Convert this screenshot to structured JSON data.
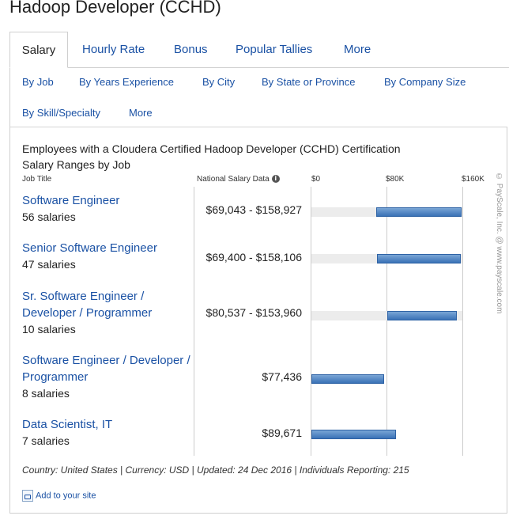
{
  "page": {
    "title": "Hadoop Developer (CCHD)"
  },
  "tabs": [
    {
      "label": "Salary",
      "active": true
    },
    {
      "label": "Hourly Rate"
    },
    {
      "label": "Bonus"
    },
    {
      "label": "Popular Tallies"
    },
    {
      "label": "More"
    }
  ],
  "subtabs": [
    {
      "label": "By Job"
    },
    {
      "label": "By Years Experience"
    },
    {
      "label": "By City"
    },
    {
      "label": "By State or Province"
    },
    {
      "label": "By Company Size"
    },
    {
      "label": "By Skill/Specialty"
    },
    {
      "label": "More"
    }
  ],
  "report": {
    "heading": "Employees with a Cloudera Certified Hadoop Developer (CCHD) Certification",
    "subheading": "Salary Ranges by Job",
    "col_job_title": "Job Title",
    "col_national": "National Salary Data",
    "info_glyph": "i",
    "axis_ticks": [
      "$0",
      "$80K",
      "$160K"
    ],
    "axis_max": 160000,
    "rows": [
      {
        "title": "Software Engineer",
        "count": "56 salaries",
        "salary": "$69,043 - $158,927",
        "low": 69043,
        "high": 158927
      },
      {
        "title": "Senior Software Engineer",
        "count": "47 salaries",
        "salary": "$69,400 - $158,106",
        "low": 69400,
        "high": 158106
      },
      {
        "title": "Sr. Software Engineer / Developer / Programmer",
        "count": "10 salaries",
        "salary": "$80,537 - $153,960",
        "low": 80537,
        "high": 153960
      },
      {
        "title": "Software Engineer / Developer / Programmer",
        "count": "8 salaries",
        "salary": "$77,436",
        "low": 0,
        "high": 77436
      },
      {
        "title": "Data Scientist, IT",
        "count": "7 salaries",
        "salary": "$89,671",
        "low": 0,
        "high": 89671
      }
    ],
    "footer": "Country: United States | Currency: USD | Updated: 24 Dec 2016 | Individuals Reporting: 215",
    "add_link": "Add to your site",
    "credit": "© PayScale, Inc. @ www.payscale.com"
  },
  "colors": {
    "link": "#1a51a4",
    "bar": "#3a72b6",
    "track": "#ececec"
  }
}
